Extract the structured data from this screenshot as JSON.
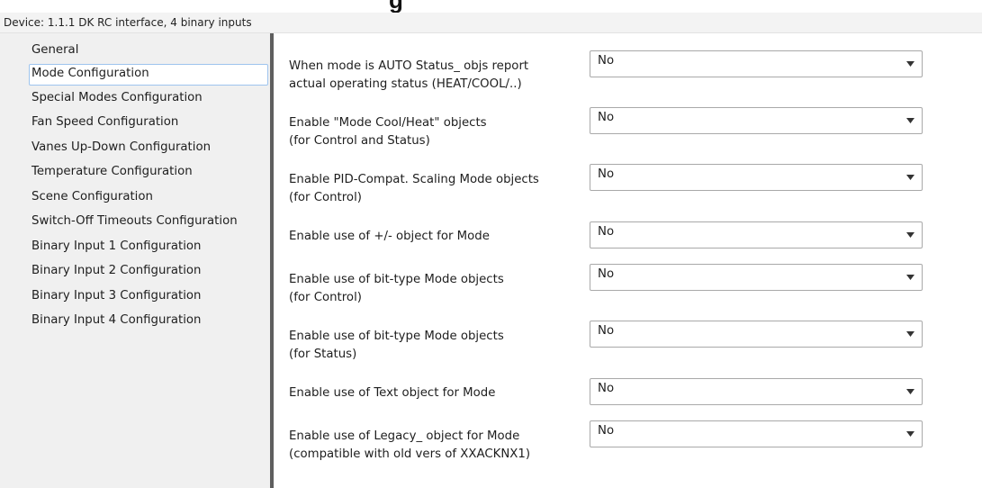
{
  "device_bar": {
    "text": "Device: 1.1.1  DK RC interface, 4 binary inputs"
  },
  "sidebar": {
    "selected_index": 1,
    "items": [
      "General",
      "Mode Configuration",
      "Special Modes Configuration",
      "Fan Speed Configuration",
      "Vanes Up-Down Configuration",
      "Temperature Configuration",
      "Scene Configuration",
      "Switch-Off Timeouts Configuration",
      "Binary Input 1 Configuration",
      "Binary Input 2 Configuration",
      "Binary Input 3 Configuration",
      "Binary Input 4 Configuration"
    ]
  },
  "params": [
    {
      "label": "When mode is AUTO Status_ objs report\nactual operating status (HEAT/COOL/..)",
      "value": "No"
    },
    {
      "label": "Enable \"Mode Cool/Heat\" objects\n(for Control and Status)",
      "value": "No"
    },
    {
      "label": "Enable PID-Compat. Scaling Mode objects\n(for Control)",
      "value": "No"
    },
    {
      "label": "Enable use of +/- object for Mode",
      "value": "No"
    },
    {
      "label": "Enable use of bit-type Mode objects\n(for Control)",
      "value": "No"
    },
    {
      "label": "Enable use of bit-type Mode objects\n(for Status)",
      "value": "No"
    },
    {
      "label": "Enable use of Text object for Mode",
      "value": "No"
    },
    {
      "label": "Enable use of Legacy_ object for Mode\n(compatible with old vers of XXACKNX1)",
      "value": "No"
    }
  ],
  "colors": {
    "sidebar_bg": "#f0f0f0",
    "selection_border": "#9ec4ee",
    "splitter": "#5e5e5e",
    "combo_border": "#a9a9a9"
  },
  "icons": {
    "dropdown": "chevron-down-icon"
  }
}
